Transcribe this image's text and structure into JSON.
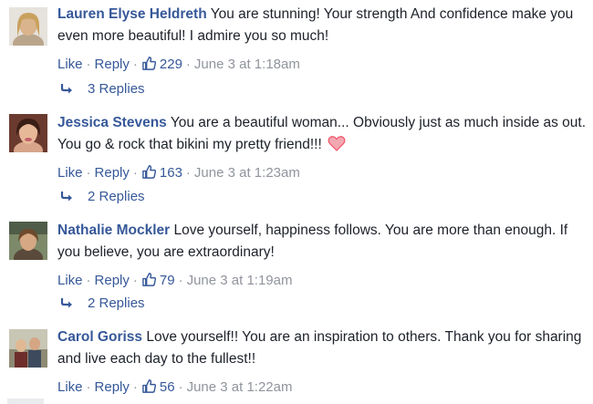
{
  "colors": {
    "link": "#365899",
    "meta": "#90949c",
    "text": "#1d2129",
    "heart": "#f25268"
  },
  "comments": [
    {
      "author": "Lauren Elyse Heldreth",
      "text": "You are stunning! Your strength And confidence make you even more beautiful! I admire you so much!",
      "like_label": "Like",
      "reply_label": "Reply",
      "likes": "229",
      "timestamp": "June 3 at 1:18am",
      "replies": "3 Replies"
    },
    {
      "author": "Jessica Stevens",
      "text": "You are a beautiful woman... Obviously just as much inside as out. You go & rock that bikini my pretty friend!!!",
      "emoji": "heart-icon",
      "like_label": "Like",
      "reply_label": "Reply",
      "likes": "163",
      "timestamp": "June 3 at 1:23am",
      "replies": "2 Replies"
    },
    {
      "author": "Nathalie Mockler",
      "text": "Love yourself, happiness follows. You are more than enough. If you believe, you are extraordinary!",
      "like_label": "Like",
      "reply_label": "Reply",
      "likes": "79",
      "timestamp": "June 3 at 1:19am",
      "replies": "2 Replies"
    },
    {
      "author": "Carol Goriss",
      "text": "Love yourself!! You are an inspiration to others. Thank you for sharing and live each day to the fullest!!",
      "like_label": "Like",
      "reply_label": "Reply",
      "likes": "56",
      "timestamp": "June 3 at 1:22am"
    }
  ]
}
